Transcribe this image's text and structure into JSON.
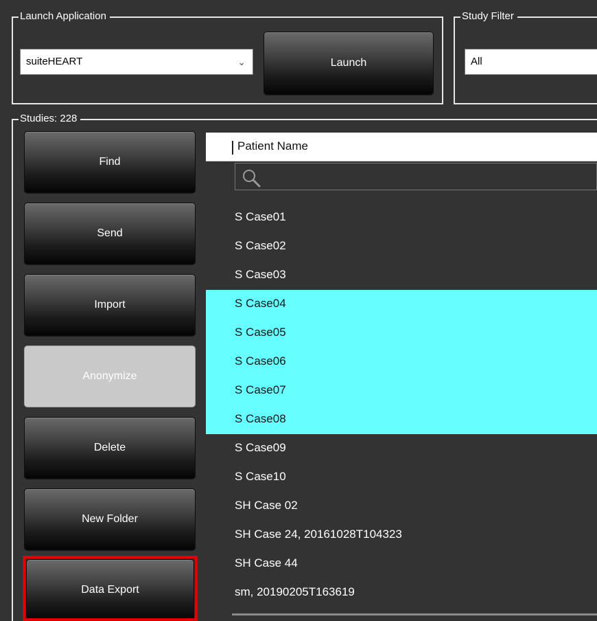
{
  "launch_group": {
    "label": "Launch Application",
    "application_select": "suiteHEART",
    "launch_button": "Launch"
  },
  "study_filter": {
    "label": "Study Filter",
    "value": "All"
  },
  "studies": {
    "label": "Studies: 228"
  },
  "side_buttons": {
    "find": "Find",
    "send": "Send",
    "import": "Import",
    "anonymize": "Anonymize",
    "delete": "Delete",
    "new_folder": "New Folder",
    "data_export": "Data Export"
  },
  "table": {
    "column_header": "Patient Name",
    "search_placeholder": "",
    "rows": [
      {
        "name": "S Case01",
        "selected": false
      },
      {
        "name": "S Case02",
        "selected": false
      },
      {
        "name": "S Case03",
        "selected": false
      },
      {
        "name": "S Case04",
        "selected": true
      },
      {
        "name": "S Case05",
        "selected": true
      },
      {
        "name": "S Case06",
        "selected": true
      },
      {
        "name": "S Case07",
        "selected": true
      },
      {
        "name": "S Case08",
        "selected": true
      },
      {
        "name": "S Case09",
        "selected": false
      },
      {
        "name": "S Case10",
        "selected": false
      },
      {
        "name": "SH Case 02",
        "selected": false
      },
      {
        "name": "SH Case 24, 20161028T104323",
        "selected": false
      },
      {
        "name": "SH Case 44",
        "selected": false
      },
      {
        "name": "sm, 20190205T163619",
        "selected": false
      }
    ]
  },
  "colors": {
    "background": "#333333",
    "selection": "#66ffff",
    "highlight_frame": "#e30000"
  },
  "icons": {
    "dropdown": "chevron-down-icon",
    "search": "search-icon"
  }
}
